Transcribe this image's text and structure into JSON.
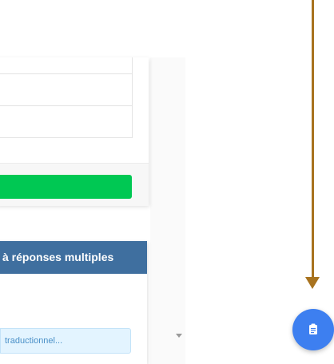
{
  "bottom_card": {
    "header_text": "à réponses multiples",
    "input_placeholder": "traductionnel..."
  },
  "colors": {
    "green_button": "#00c853",
    "header_bg": "#3f6f9f",
    "input_bg": "#e3f4ff",
    "input_text": "#4a90c8",
    "fab_bg": "#3d7ff0",
    "annotation_arrow": "#a8731f"
  },
  "icons": {
    "fab": "clipboard-icon",
    "scroll": "scroll-down-arrow-icon"
  }
}
